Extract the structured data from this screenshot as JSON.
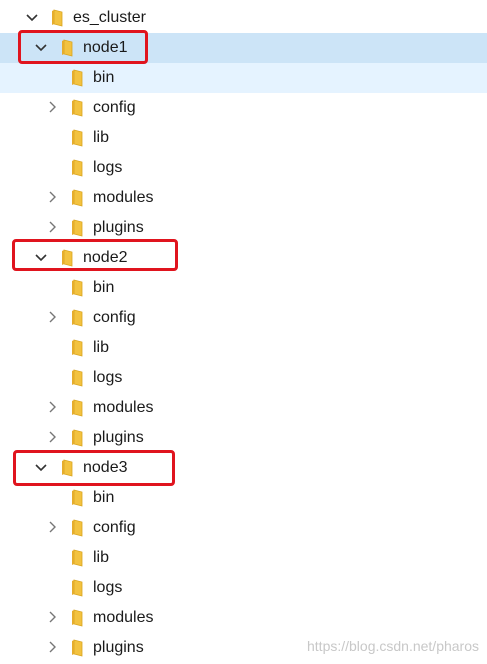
{
  "tree": {
    "root": {
      "label": "es_cluster",
      "expanded": true
    },
    "nodes": [
      {
        "label": "node1",
        "expanded": true,
        "highlighted": true,
        "children": [
          {
            "label": "bin",
            "expandable": false
          },
          {
            "label": "config",
            "expandable": true
          },
          {
            "label": "lib",
            "expandable": false
          },
          {
            "label": "logs",
            "expandable": false
          },
          {
            "label": "modules",
            "expandable": true
          },
          {
            "label": "plugins",
            "expandable": true
          }
        ]
      },
      {
        "label": "node2",
        "expanded": true,
        "highlighted": true,
        "children": [
          {
            "label": "bin",
            "expandable": false
          },
          {
            "label": "config",
            "expandable": true
          },
          {
            "label": "lib",
            "expandable": false
          },
          {
            "label": "logs",
            "expandable": false
          },
          {
            "label": "modules",
            "expandable": true
          },
          {
            "label": "plugins",
            "expandable": true
          }
        ]
      },
      {
        "label": "node3",
        "expanded": true,
        "highlighted": true,
        "children": [
          {
            "label": "bin",
            "expandable": false
          },
          {
            "label": "config",
            "expandable": true
          },
          {
            "label": "lib",
            "expandable": false
          },
          {
            "label": "logs",
            "expandable": false
          },
          {
            "label": "modules",
            "expandable": true
          },
          {
            "label": "plugins",
            "expandable": true
          }
        ]
      }
    ]
  },
  "colors": {
    "selected_row": "#cce4f7",
    "hover_row": "#e5f3ff",
    "highlight_box": "#e0141e",
    "folder": "#f3c23f"
  },
  "icons": {
    "folder": "folder-icon",
    "expanded": "chevron-down-icon",
    "collapsed": "chevron-right-icon"
  },
  "watermark": "https://blog.csdn.net/pharos"
}
